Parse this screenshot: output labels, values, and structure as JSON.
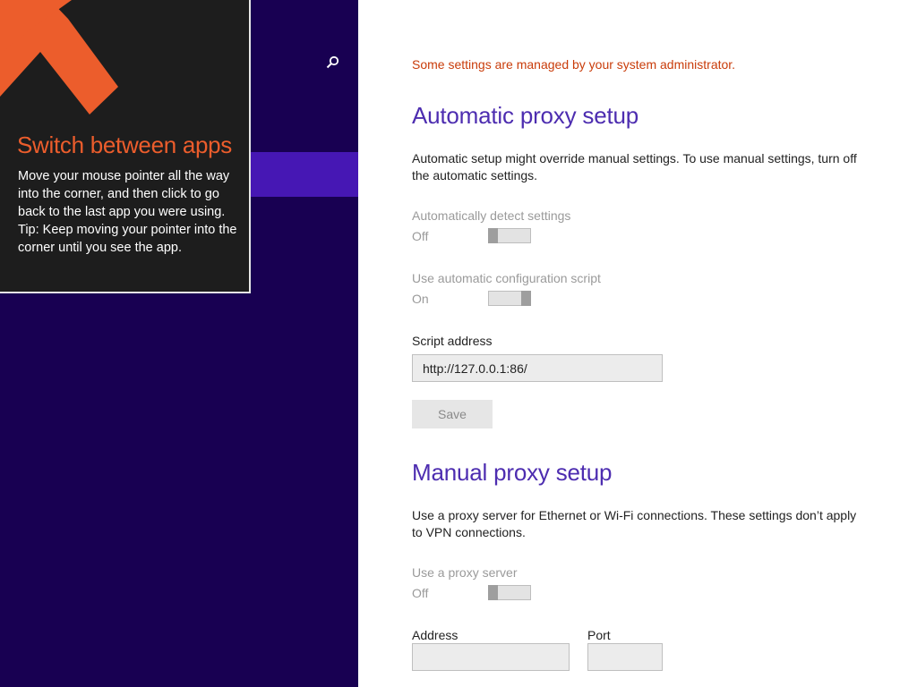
{
  "tip": {
    "title": "Switch between apps",
    "body_line1": "Move your mouse pointer all the way into the corner, and then click to go back to the last app you were using.",
    "body_line2": "Tip: Keep moving your pointer into the corner until you see the app.",
    "accent_color": "#ec5d2c"
  },
  "sidebar": {
    "search_icon": "search-icon",
    "background_color": "#180052",
    "selected_color": "#4617b4"
  },
  "proxy": {
    "admin_note": "Some settings are managed by your system administrator.",
    "automatic": {
      "title": "Automatic proxy setup",
      "description": "Automatic setup might override manual settings. To use manual settings, turn off the automatic settings.",
      "detect_label": "Automatically detect settings",
      "detect_state": "Off",
      "script_label": "Use automatic configuration script",
      "script_state": "On",
      "address_label": "Script address",
      "address_value": "http://127.0.0.1:86/",
      "save_label": "Save"
    },
    "manual": {
      "title": "Manual proxy setup",
      "description": "Use a proxy server for Ethernet or Wi-Fi connections. These settings don’t apply to VPN connections.",
      "use_proxy_label": "Use a proxy server",
      "use_proxy_state": "Off",
      "address_label": "Address",
      "address_value": "",
      "port_label": "Port",
      "port_value": ""
    }
  }
}
